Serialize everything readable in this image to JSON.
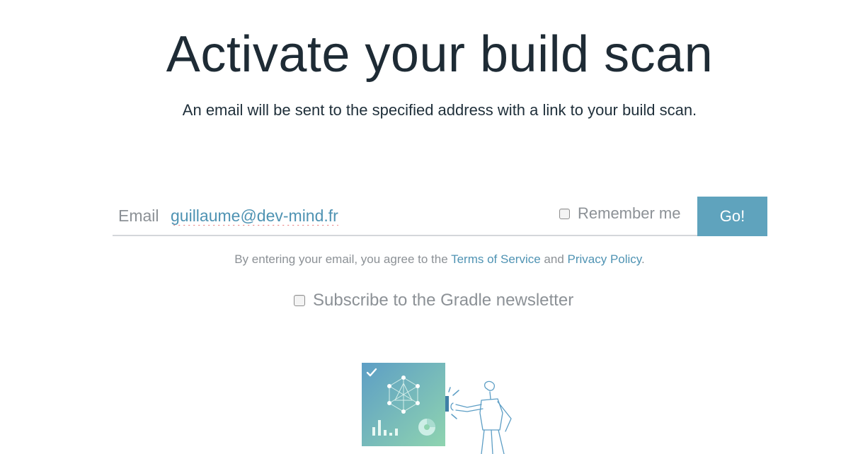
{
  "page": {
    "title": "Activate your build scan",
    "subtitle": "An email will be sent to the specified address with a link to your build scan."
  },
  "form": {
    "email_label": "Email",
    "email_value": "guillaume@dev-mind.fr",
    "remember_label": "Remember me",
    "remember_checked": false,
    "go_label": "Go!"
  },
  "agreement": {
    "prefix": "By entering your email, you agree to the ",
    "terms_link": "Terms of Service",
    "and": " and ",
    "privacy_link": "Privacy Policy",
    "suffix": "."
  },
  "newsletter": {
    "label": "Subscribe to the Gradle newsletter",
    "checked": false
  },
  "illustration": {
    "icons": [
      "check-icon",
      "network-graph-icon",
      "bar-chart-icon",
      "pie-chart-icon",
      "person-pushing-panel"
    ]
  },
  "colors": {
    "title": "#1e2b35",
    "accent": "#5fa3bd",
    "link": "#4f93b3",
    "muted_text": "#8c9196",
    "illustration_gradient_start": "#5d9ec5",
    "illustration_gradient_end": "#8fd4b0"
  }
}
